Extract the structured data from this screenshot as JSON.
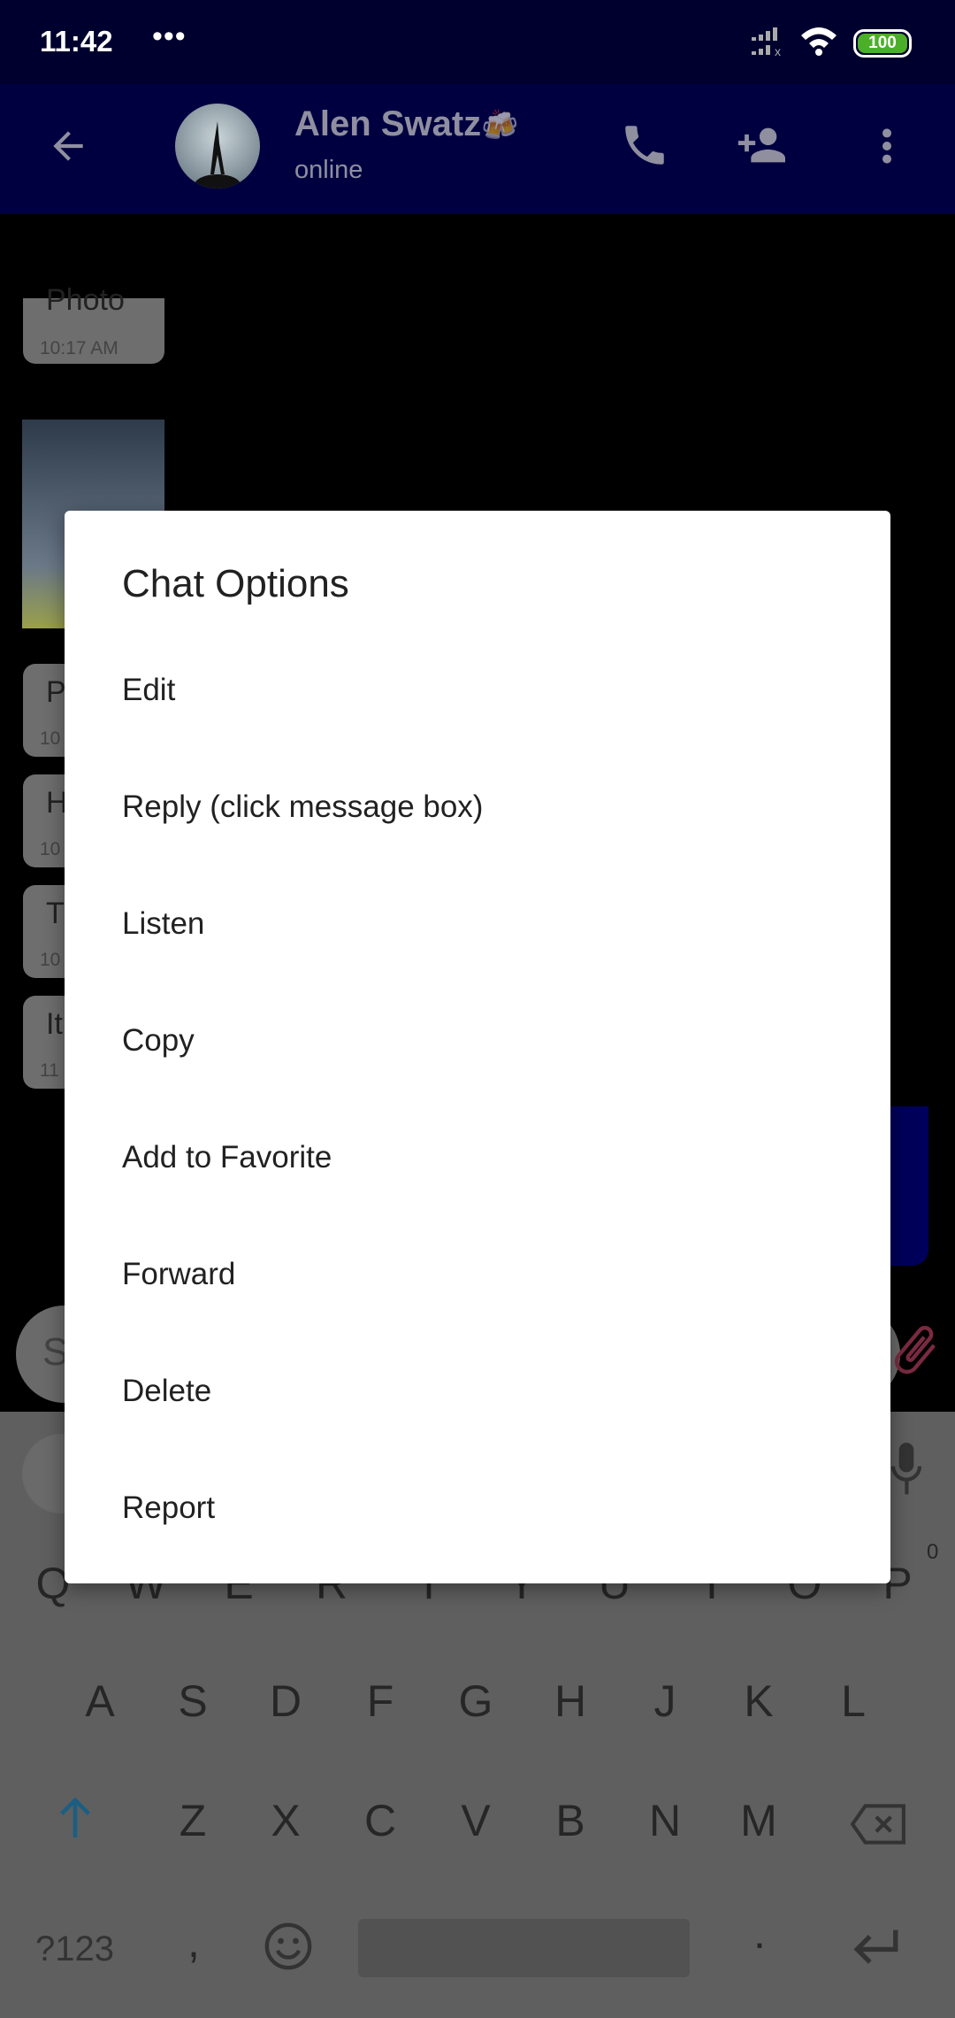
{
  "status_bar": {
    "time": "11:42",
    "notification_dots": "•••",
    "battery": "100",
    "battery_color": "#4caf2a"
  },
  "header": {
    "name": "Alen Swatz",
    "name_emoji": "🍻",
    "presence": "online",
    "bg_color": "#000040"
  },
  "chat": {
    "messages": [
      {
        "text": "Photo",
        "time": "10:17 AM"
      },
      {
        "text": "P",
        "time": "10"
      },
      {
        "text": "H",
        "time": "10"
      },
      {
        "text": "T",
        "time": "10"
      },
      {
        "text": "It",
        "time": "11"
      }
    ],
    "input_placeholder": "S"
  },
  "dialog": {
    "title": "Chat Options",
    "items": [
      "Edit",
      "Reply (click message box)",
      "Listen",
      "Copy",
      "Add to Favorite",
      "Forward",
      "Delete",
      "Report"
    ]
  },
  "keyboard": {
    "rows": [
      [
        "Q",
        "W",
        "E",
        "R",
        "T",
        "Y",
        "U",
        "I",
        "O",
        "P"
      ],
      [
        "A",
        "S",
        "D",
        "F",
        "G",
        "H",
        "J",
        "K",
        "L"
      ],
      [
        "Z",
        "X",
        "C",
        "V",
        "B",
        "N",
        "M"
      ]
    ],
    "p_hint": "0",
    "symbols_key": "?123",
    "comma": ",",
    "period": ".",
    "shift_color": "#1a5f82"
  }
}
